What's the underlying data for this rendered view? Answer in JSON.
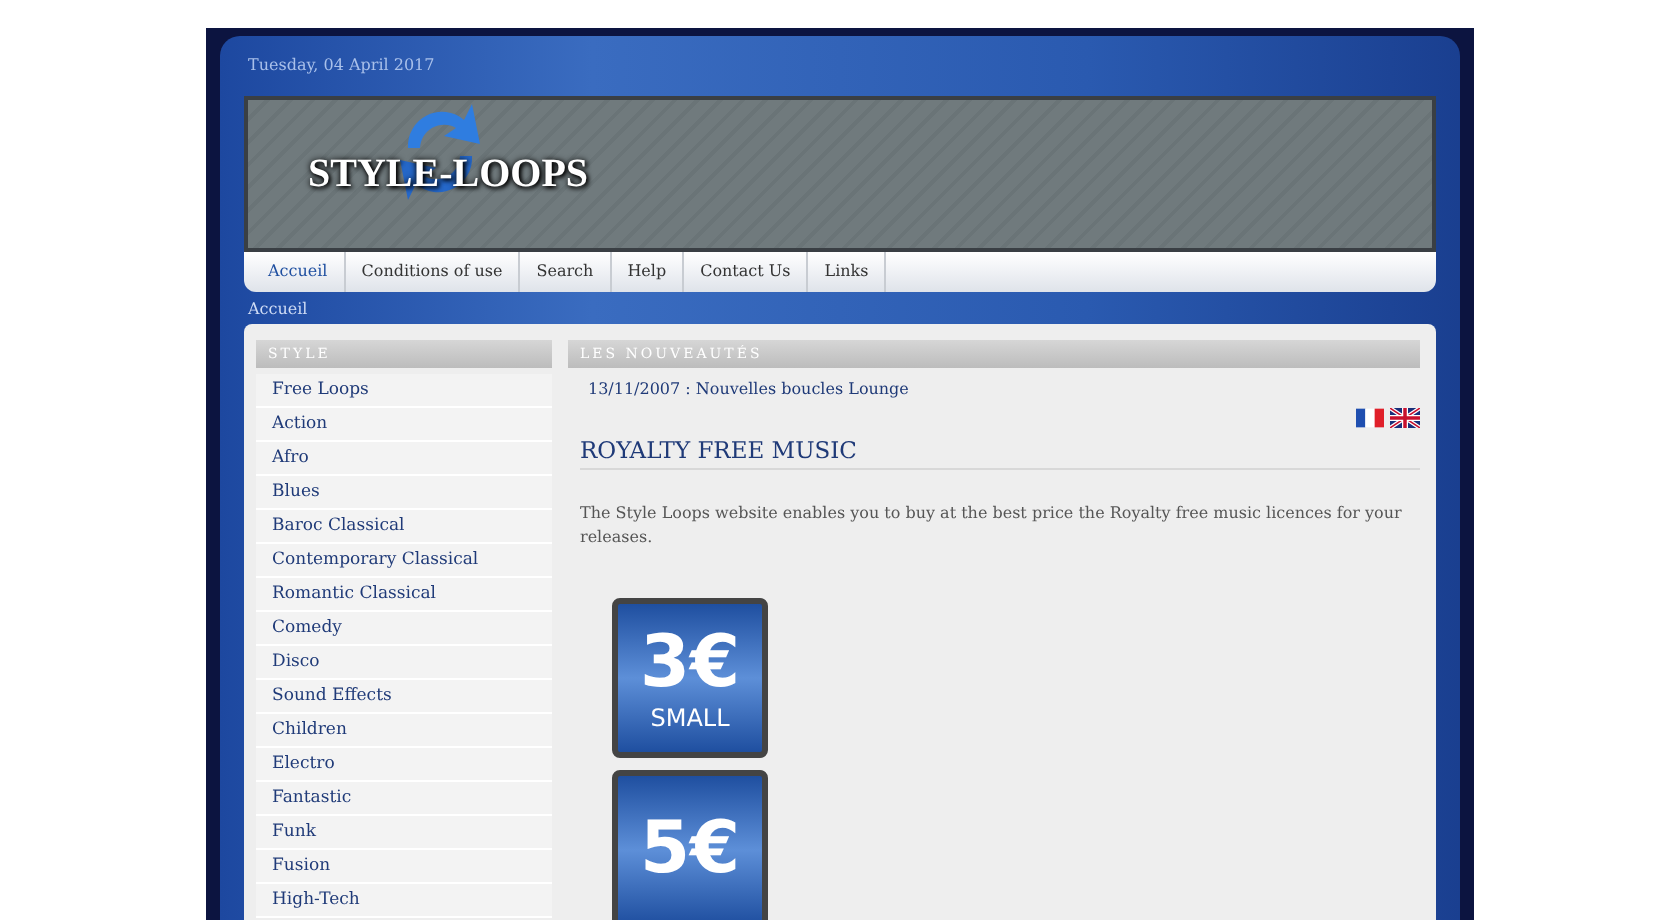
{
  "header": {
    "date": "Tuesday, 04 April 2017",
    "logo": "STYLE-LOOPS"
  },
  "nav": [
    {
      "label": "Accueil",
      "selected": true
    },
    {
      "label": "Conditions of use",
      "selected": false
    },
    {
      "label": "Search",
      "selected": false
    },
    {
      "label": "Help",
      "selected": false
    },
    {
      "label": "Contact Us",
      "selected": false
    },
    {
      "label": "Links",
      "selected": false
    }
  ],
  "breadcrumb": "Accueil",
  "sidebar": {
    "title": "STYLE",
    "items": [
      "Free Loops",
      "Action",
      "Afro",
      "Blues",
      "Baroc Classical",
      "Contemporary Classical",
      "Romantic Classical",
      "Comedy",
      "Disco",
      "Sound Effects",
      "Children",
      "Electro",
      "Fantastic",
      "Funk",
      "Fusion",
      "High-Tech"
    ]
  },
  "news": {
    "title": "LES NOUVEAUTÉS",
    "items": [
      "13/11/2007 : Nouvelles boucles Lounge"
    ]
  },
  "article": {
    "title": "ROYALTY FREE MUSIC",
    "text": "The Style Loops website enables you to buy at the best price the Royalty free music licences for your releases."
  },
  "price_badges": [
    {
      "price": "3€",
      "label": "SMALL"
    },
    {
      "price": "5€"
    }
  ]
}
